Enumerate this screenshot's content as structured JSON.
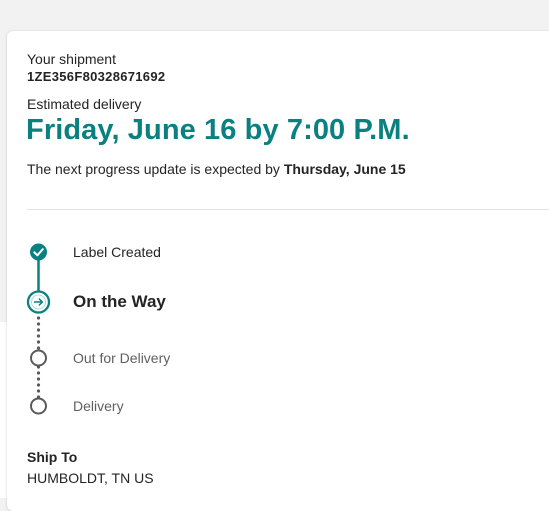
{
  "shipment": {
    "heading": "Your shipment",
    "tracking_number": "1ZE356F80328671692"
  },
  "delivery": {
    "label": "Estimated delivery",
    "date_text": "Friday, June 16 by 7:00 P.M.",
    "next_update_prefix": "The next progress update is expected by",
    "next_update_date": "Thursday, June 15"
  },
  "progress": {
    "steps": [
      {
        "label": "Label Created",
        "state": "done",
        "icon": "check-icon"
      },
      {
        "label": "On the Way",
        "state": "current",
        "icon": "arrow-right-icon"
      },
      {
        "label": "Out for Delivery",
        "state": "future",
        "icon": "empty-circle-icon"
      },
      {
        "label": "Delivery",
        "state": "future",
        "icon": "empty-circle-icon"
      }
    ]
  },
  "ship_to": {
    "title": "Ship To",
    "address": "HUMBOLDT, TN US"
  },
  "colors": {
    "accent": "#0a8080",
    "future_step": "#6f6f6f"
  }
}
